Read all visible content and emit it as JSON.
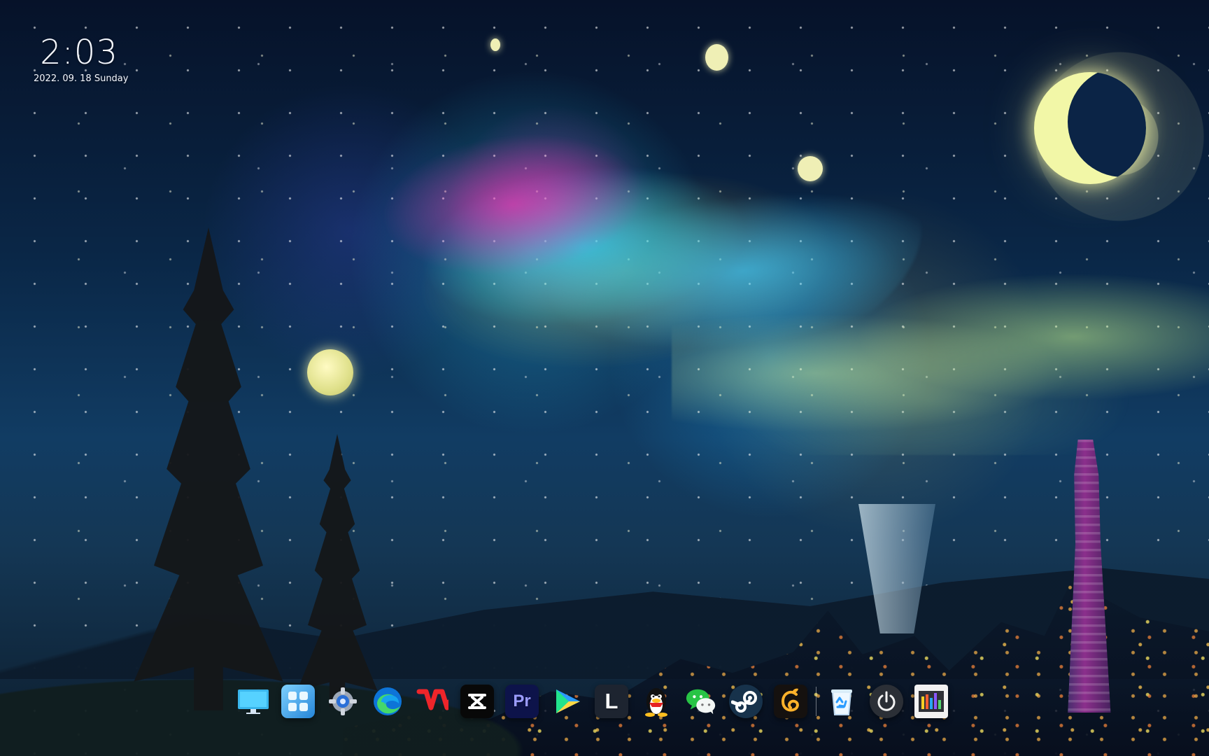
{
  "clock": {
    "time": "2:03",
    "date": "2022. 09. 18  Sunday"
  },
  "dock": {
    "items": [
      {
        "name": "this-pc",
        "icon": "desktop-icon"
      },
      {
        "name": "start-menu",
        "icon": "windows-start-icon"
      },
      {
        "name": "settings",
        "icon": "gear-icon"
      },
      {
        "name": "edge",
        "icon": "edge-icon"
      },
      {
        "name": "wps",
        "icon": "wps-icon"
      },
      {
        "name": "capcut",
        "icon": "capcut-icon"
      },
      {
        "name": "premiere-pro",
        "icon": "premiere-pro-icon",
        "label": "Pr"
      },
      {
        "name": "media-player",
        "icon": "play-icon"
      },
      {
        "name": "lightroom",
        "icon": "lightroom-icon",
        "label": "L"
      },
      {
        "name": "qq",
        "icon": "qq-penguin-icon"
      },
      {
        "name": "wechat",
        "icon": "wechat-icon"
      },
      {
        "name": "steam",
        "icon": "steam-icon"
      },
      {
        "name": "miyou",
        "icon": "sprout-icon"
      },
      {
        "name": "recycle-bin",
        "icon": "recycle-bin-icon"
      },
      {
        "name": "power",
        "icon": "power-icon"
      },
      {
        "name": "task-manager",
        "icon": "task-manager-icon"
      }
    ],
    "colors": {
      "premiere": "#0d134a",
      "premiere_text": "#9b9cff",
      "lightroom": "#1d2430",
      "steam": "#17324b",
      "power": "#2b2f36"
    }
  }
}
